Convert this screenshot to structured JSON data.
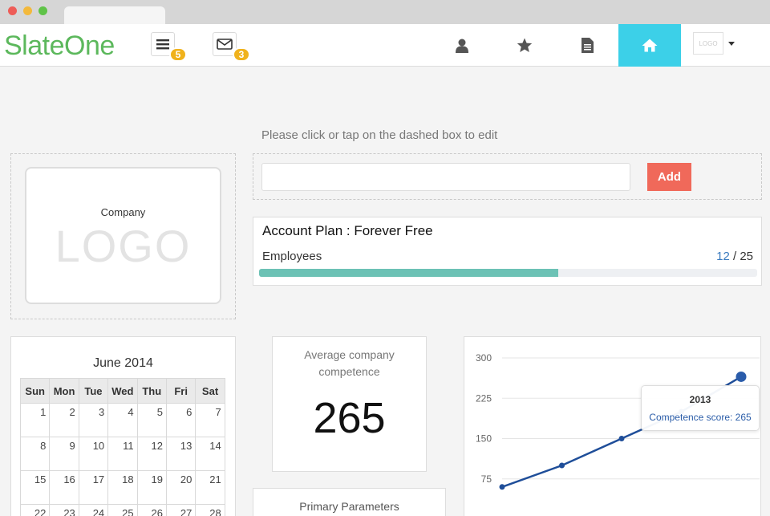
{
  "app": {
    "brand": "SlateOne"
  },
  "header": {
    "menu_badge": "5",
    "mail_badge": "3",
    "logo_mini": "LOGO",
    "icons": [
      "bars-icon",
      "envelope-icon",
      "user-icon",
      "star-icon",
      "file-icon",
      "home-icon"
    ]
  },
  "editor": {
    "hint": "Please click or tap on the dashed box to edit",
    "input_value": "",
    "add_label": "Add"
  },
  "logo_card": {
    "company": "Company",
    "logo": "LOGO"
  },
  "plan": {
    "label": "Account Plan",
    "separator": " : ",
    "value": "Forever Free",
    "employees_label": "Employees",
    "used": "12",
    "sep": " / ",
    "total": "25",
    "progress_fraction": 0.6
  },
  "calendar": {
    "title": "June 2014",
    "weekdays": [
      "Sun",
      "Mon",
      "Tue",
      "Wed",
      "Thu",
      "Fri",
      "Sat"
    ],
    "weeks": [
      [
        "1",
        "2",
        "3",
        "4",
        "5",
        "6",
        "7"
      ],
      [
        "8",
        "9",
        "10",
        "11",
        "12",
        "13",
        "14"
      ],
      [
        "15",
        "16",
        "17",
        "18",
        "19",
        "20",
        "21"
      ],
      [
        "22",
        "23",
        "24",
        "25",
        "26",
        "27",
        "28"
      ]
    ]
  },
  "competence": {
    "title": "Average company competence",
    "value": "265"
  },
  "params": {
    "title": "Primary Parameters"
  },
  "chart_data": {
    "type": "line",
    "y_ticks": [
      "300",
      "225",
      "150",
      "75"
    ],
    "ylim": [
      0,
      300
    ],
    "grid": true,
    "series": [
      {
        "values": [
          60,
          100,
          150,
          200,
          265
        ]
      }
    ],
    "tooltip": {
      "year": "2013",
      "label": "Competence score: 265"
    },
    "colors": {
      "line": "#1f4e99",
      "highlight": "#2a5caa"
    }
  },
  "colors": {
    "brand": "#5cb85c",
    "badge": "#f0b21c",
    "home_active": "#3cd0e8",
    "add_button": "#f0695a",
    "progress": "#6cc2b5"
  }
}
